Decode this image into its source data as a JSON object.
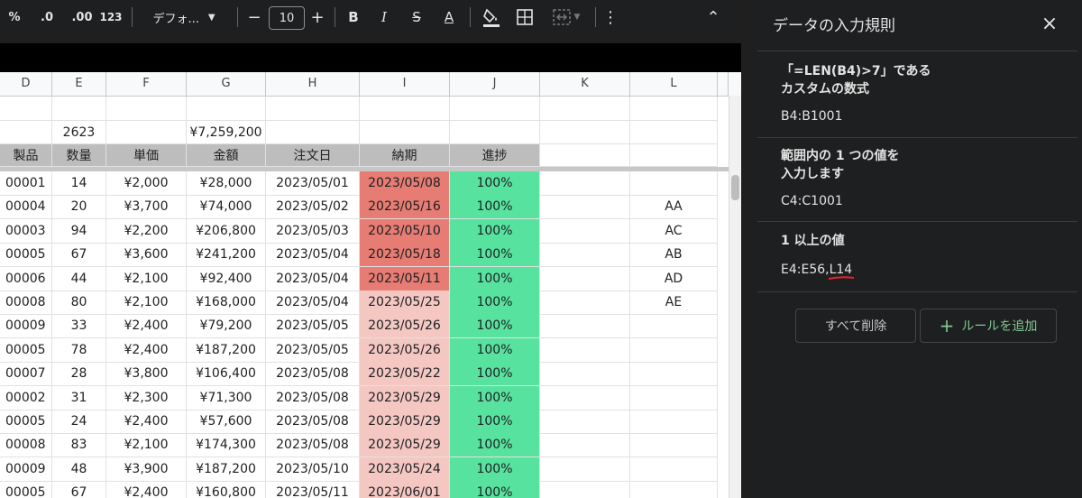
{
  "toolbar": {
    "percent": "%",
    "dec_minus": ".0",
    "dec_plus": ".00",
    "number_fmt": "123",
    "font": "デフォ...",
    "size_minus": "−",
    "font_size": "10",
    "size_plus": "+",
    "bold": "B",
    "italic": "I",
    "strike": "S",
    "text_color": "A",
    "more": "⋮",
    "collapse": "⌃"
  },
  "sheet": {
    "columns": [
      "D",
      "E",
      "F",
      "G",
      "H",
      "I",
      "J",
      "K",
      "L"
    ],
    "summary": {
      "quantity_total": "2623",
      "amount_total": "¥7,259,200"
    },
    "headers": [
      "製品",
      "数量",
      "単価",
      "金額",
      "注文日",
      "納期",
      "進捗"
    ],
    "rows": [
      {
        "d": "00001",
        "e": "14",
        "f": "¥2,000",
        "g": "¥28,000",
        "h": "2023/05/01",
        "i": "2023/05/08",
        "j": "100%",
        "l": ""
      },
      {
        "d": "00004",
        "e": "20",
        "f": "¥3,700",
        "g": "¥74,000",
        "h": "2023/05/02",
        "i": "2023/05/16",
        "j": "100%",
        "l": "AA"
      },
      {
        "d": "00003",
        "e": "94",
        "f": "¥2,200",
        "g": "¥206,800",
        "h": "2023/05/03",
        "i": "2023/05/10",
        "j": "100%",
        "l": "AC"
      },
      {
        "d": "00005",
        "e": "67",
        "f": "¥3,600",
        "g": "¥241,200",
        "h": "2023/05/04",
        "i": "2023/05/18",
        "j": "100%",
        "l": "AB"
      },
      {
        "d": "00006",
        "e": "44",
        "f": "¥2,100",
        "g": "¥92,400",
        "h": "2023/05/04",
        "i": "2023/05/11",
        "j": "100%",
        "l": "AD"
      },
      {
        "d": "00008",
        "e": "80",
        "f": "¥2,100",
        "g": "¥168,000",
        "h": "2023/05/04",
        "i": "2023/05/25",
        "j": "100%",
        "l": "AE"
      },
      {
        "d": "00009",
        "e": "33",
        "f": "¥2,400",
        "g": "¥79,200",
        "h": "2023/05/05",
        "i": "2023/05/26",
        "j": "100%",
        "l": ""
      },
      {
        "d": "00005",
        "e": "78",
        "f": "¥2,400",
        "g": "¥187,200",
        "h": "2023/05/05",
        "i": "2023/05/26",
        "j": "100%",
        "l": ""
      },
      {
        "d": "00007",
        "e": "28",
        "f": "¥3,800",
        "g": "¥106,400",
        "h": "2023/05/08",
        "i": "2023/05/22",
        "j": "100%",
        "l": ""
      },
      {
        "d": "00002",
        "e": "31",
        "f": "¥2,300",
        "g": "¥71,300",
        "h": "2023/05/08",
        "i": "2023/05/29",
        "j": "100%",
        "l": ""
      },
      {
        "d": "00005",
        "e": "24",
        "f": "¥2,400",
        "g": "¥57,600",
        "h": "2023/05/08",
        "i": "2023/05/29",
        "j": "100%",
        "l": ""
      },
      {
        "d": "00008",
        "e": "83",
        "f": "¥2,100",
        "g": "¥174,300",
        "h": "2023/05/08",
        "i": "2023/05/29",
        "j": "100%",
        "l": ""
      },
      {
        "d": "00009",
        "e": "48",
        "f": "¥3,900",
        "g": "¥187,200",
        "h": "2023/05/10",
        "i": "2023/05/24",
        "j": "100%",
        "l": ""
      },
      {
        "d": "00005",
        "e": "67",
        "f": "¥2,400",
        "g": "¥160,800",
        "h": "2023/05/11",
        "i": "2023/06/01",
        "j": "100%",
        "l": ""
      }
    ],
    "colors": {
      "due_strong": "#e67c73",
      "due_light": "#f4c7c3",
      "progress": "#57e39f",
      "header_bg": "#bdbdbd"
    }
  },
  "panel": {
    "title": "データの入力規則",
    "close": "×",
    "rules": [
      {
        "title": "「=LEN(B4)>7」である\nカスタムの数式",
        "range": "B4:B1001"
      },
      {
        "title": "範囲内の 1 つの値を\n入力します",
        "range": "C4:C1001"
      },
      {
        "title": "1 以上の値",
        "range": "E4:E56,L14"
      }
    ],
    "delete_all": "すべて削除",
    "add_rule": "ルールを追加",
    "add_icon": "+",
    "accent": "#81c995"
  }
}
